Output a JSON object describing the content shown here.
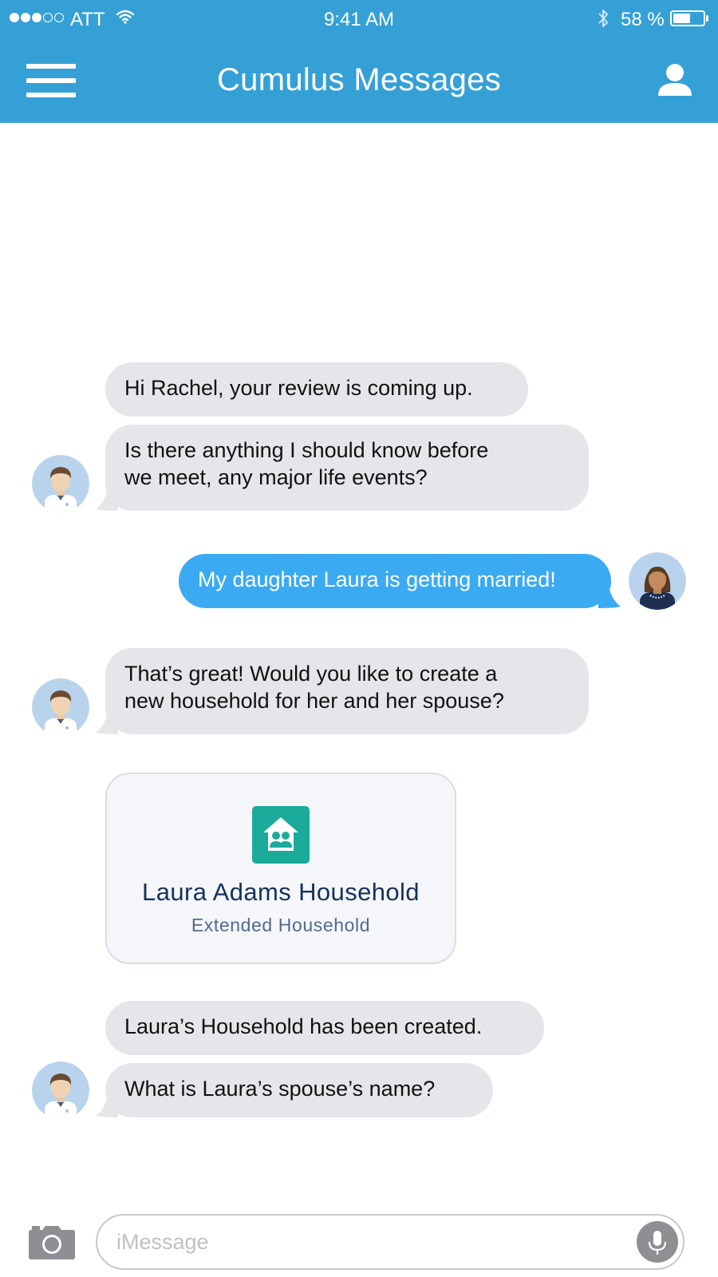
{
  "status_bar": {
    "carrier": "ATT",
    "time": "9:41 AM",
    "battery_text": "58 %",
    "battery_level": 0.58,
    "signal_bars_filled": 3,
    "signal_bars_total": 5
  },
  "header": {
    "title": "Cumulus Messages",
    "menu_icon": "hamburger-menu-icon",
    "profile_icon": "user-profile-icon"
  },
  "messages": [
    {
      "direction": "incoming",
      "text": "Hi Rachel, your review is coming up."
    },
    {
      "direction": "incoming",
      "line1": "Is there anything I should know before",
      "line2": "we meet, any major life events?"
    },
    {
      "direction": "outgoing",
      "text": "My daughter Laura is getting married!"
    },
    {
      "direction": "incoming",
      "line1": "That’s great! Would you like to create a",
      "line2": "new household for her and her spouse?"
    },
    {
      "direction": "incoming",
      "text": "Laura’s Household has been created."
    },
    {
      "direction": "incoming",
      "text": "What is Laura’s spouse’s name?"
    }
  ],
  "household_card": {
    "title": "Laura Adams Household",
    "subtitle": "Extended Household",
    "icon": "household-icon"
  },
  "compose": {
    "placeholder": "iMessage",
    "value": "",
    "camera_icon": "camera-icon",
    "mic_icon": "microphone-icon"
  },
  "colors": {
    "header_bg": "#35a0d6",
    "incoming_bubble": "#e5e6ea",
    "outgoing_bubble": "#3aaaf3",
    "card_icon_bg": "#1aab9b",
    "card_title": "#16325c"
  }
}
